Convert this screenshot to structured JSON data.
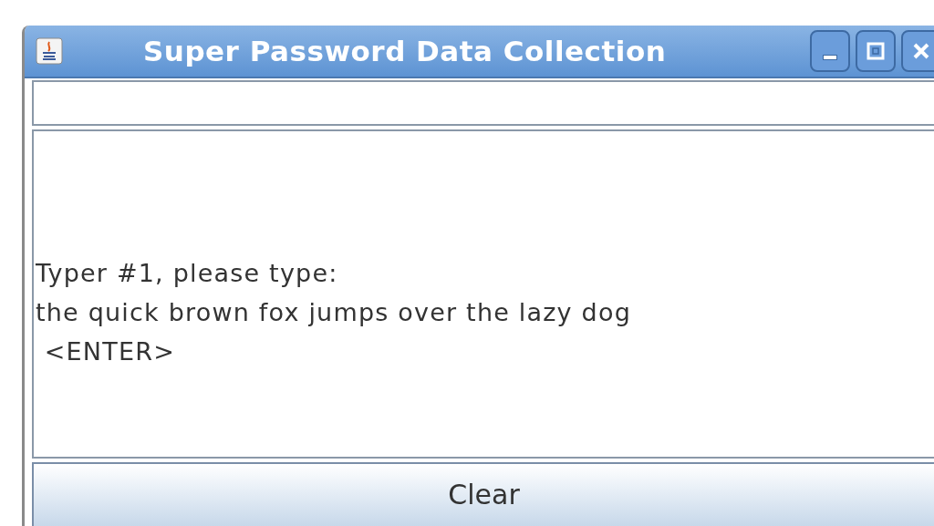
{
  "window": {
    "title": "Super Password Data Collection"
  },
  "message": {
    "lines": [
      "Typer #1, please type:",
      "the quick brown fox jumps over the lazy dog",
      " <ENTER>"
    ]
  },
  "buttons": [
    "Clear"
  ]
}
